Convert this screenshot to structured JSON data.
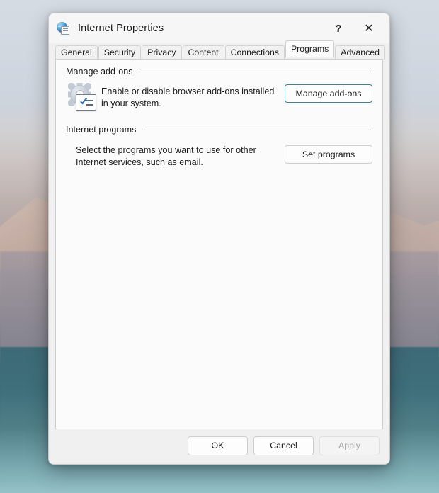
{
  "window": {
    "title": "Internet Properties",
    "icon": "internet-properties-icon",
    "help_label": "?",
    "close_label": "✕"
  },
  "tabs": [
    {
      "label": "General",
      "active": false
    },
    {
      "label": "Security",
      "active": false
    },
    {
      "label": "Privacy",
      "active": false
    },
    {
      "label": "Content",
      "active": false
    },
    {
      "label": "Connections",
      "active": false
    },
    {
      "label": "Programs",
      "active": true
    },
    {
      "label": "Advanced",
      "active": false
    }
  ],
  "groups": {
    "manage_addons": {
      "header": "Manage add-ons",
      "icon": "addons-gear-checklist-icon",
      "description": "Enable or disable browser add-ons installed in your system.",
      "button_label": "Manage add-ons",
      "button_focused": true
    },
    "internet_programs": {
      "header": "Internet programs",
      "description": "Select the programs you want to use for other Internet services, such as email.",
      "button_label": "Set programs",
      "button_focused": false
    }
  },
  "footer": {
    "ok_label": "OK",
    "cancel_label": "Cancel",
    "apply_label": "Apply",
    "apply_disabled": true
  },
  "colors": {
    "accent_focus_border": "#3b7f93",
    "dialog_background": "#f0f0f0",
    "panel_background": "#fbfbfb",
    "text": "#1b1b1b",
    "disabled_text": "#a6a6a6"
  }
}
